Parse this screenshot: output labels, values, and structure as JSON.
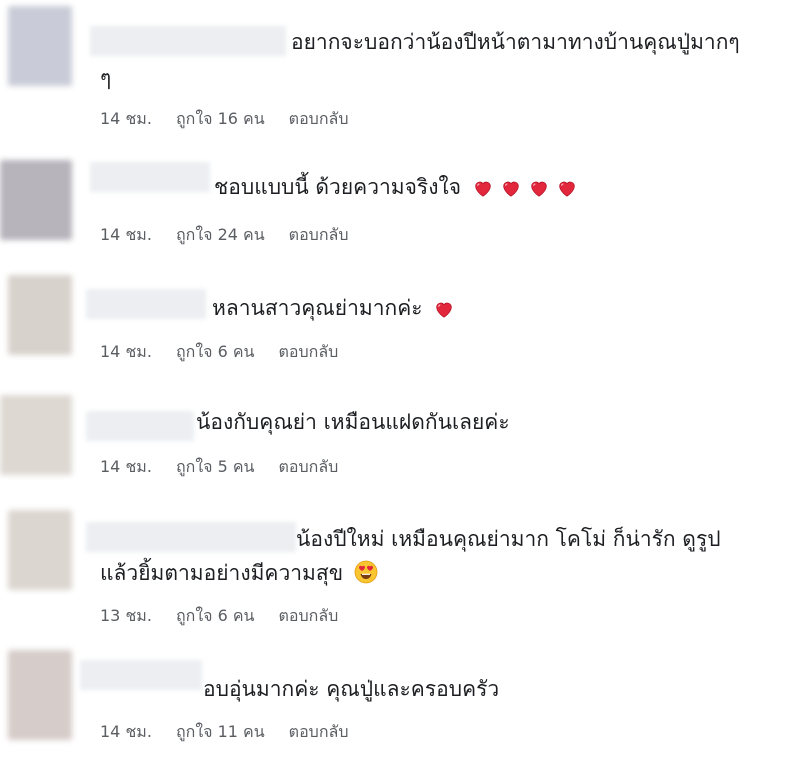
{
  "comments": [
    {
      "text_line1": "อยากจะบอกว่าน้องปีหน้าตามาทางบ้านคุณปู่มากๆ",
      "text_line2": "ๆ",
      "time": "14 ชม.",
      "likes": "ถูกใจ 16 คน",
      "reply": "ตอบกลับ",
      "avatar_color": "#c9ccd8"
    },
    {
      "text_line1": "ชอบแบบนี้ ด้วยความจริงใจ",
      "emoji": "heart-icon",
      "emoji_count": 4,
      "time": "14 ชม.",
      "likes": "ถูกใจ 24 คน",
      "reply": "ตอบกลับ",
      "avatar_color": "#b7b4bb"
    },
    {
      "text_line1": "หลานสาวคุณย่ามากค่ะ",
      "emoji": "heart-icon",
      "emoji_count": 1,
      "time": "14 ชม.",
      "likes": "ถูกใจ 6 คน",
      "reply": "ตอบกลับ",
      "avatar_color": "#d8d2cc"
    },
    {
      "text_line1": "น้องกับคุณย่า เหมือนแฝดกันเลยค่ะ",
      "time": "14 ชม.",
      "likes": "ถูกใจ 5 คน",
      "reply": "ตอบกลับ",
      "avatar_color": "#ddd8d2"
    },
    {
      "text_line1": "น้องปีใหม่ เหมือนคุณย่ามาก โคโม่ ก็น่ารัก ดูรูป",
      "text_line2": "แล้วยิ้มตามอย่างมีความสุข",
      "emoji": "heart-eyes-icon",
      "time": "13 ชม.",
      "likes": "ถูกใจ 6 คน",
      "reply": "ตอบกลับ",
      "avatar_color": "#dcd6d0"
    },
    {
      "text_line1": "อบอุ่นมากค่ะ คุณปู่และครอบครัว",
      "time": "14 ชม.",
      "likes": "ถูกใจ 11 คน",
      "reply": "ตอบกลับ",
      "avatar_color": "#d6ccc9"
    }
  ],
  "colors": {
    "heart": "#e2263c",
    "meta_text": "#5a5d62",
    "name_blur": "#eceef1"
  }
}
